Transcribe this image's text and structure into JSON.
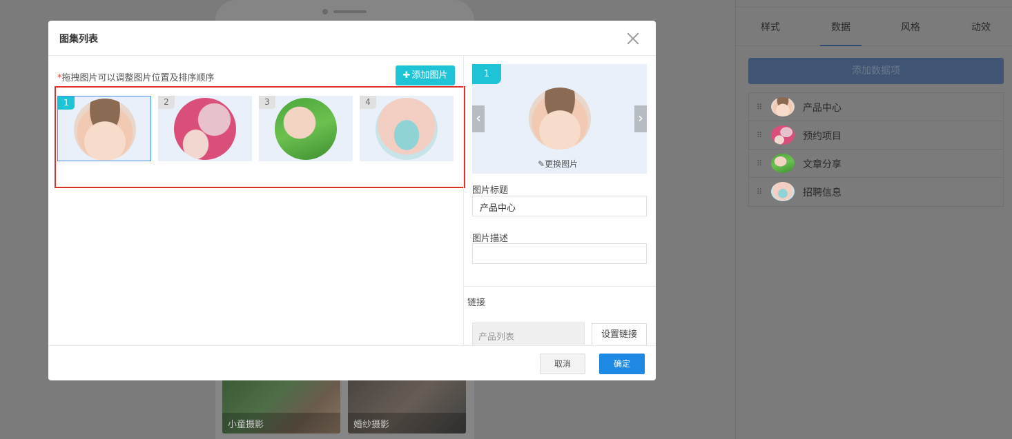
{
  "background": {
    "tiles": [
      {
        "caption": "小童摄影"
      },
      {
        "caption": "婚纱摄影"
      }
    ]
  },
  "right_panel": {
    "tabs": [
      {
        "label": "样式",
        "active": false
      },
      {
        "label": "数据",
        "active": true
      },
      {
        "label": "风格",
        "active": false
      },
      {
        "label": "动效",
        "active": false
      }
    ],
    "add_button": "添加数据项",
    "items": [
      {
        "label": "产品中心"
      },
      {
        "label": "预约项目"
      },
      {
        "label": "文章分享"
      },
      {
        "label": "招聘信息"
      }
    ]
  },
  "modal": {
    "title": "图集列表",
    "hint_star": "*",
    "hint": "拖拽图片可以调整图片位置及排序顺序",
    "add_image_button": "添加图片",
    "gallery": [
      {
        "number": "1",
        "selected": true
      },
      {
        "number": "2",
        "selected": false
      },
      {
        "number": "3",
        "selected": false
      },
      {
        "number": "4",
        "selected": false
      }
    ],
    "preview": {
      "number": "1",
      "change_image": "更换图片"
    },
    "image_title_label": "图片标题",
    "image_title_value": "产品中心",
    "image_desc_label": "图片描述",
    "image_desc_value": "",
    "link_label": "链接",
    "link_value": "产品列表",
    "set_link_button": "设置链接",
    "cancel_button": "取消",
    "ok_button": "确定"
  },
  "colors": {
    "accent_cyan": "#1ec4d6",
    "primary_blue": "#1e88e5",
    "highlight_red": "#e0302a"
  }
}
